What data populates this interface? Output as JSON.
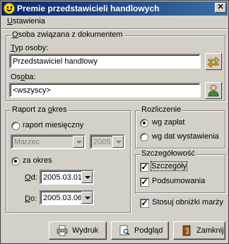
{
  "window": {
    "title": "Premie przedstawicieli handlowych"
  },
  "menu": {
    "items": [
      {
        "label_pre": "",
        "label_u": "U",
        "label_post": "stawienia"
      }
    ]
  },
  "osoba_group": {
    "legend_u": "O",
    "legend_rest": "soba związana z dokumentem",
    "typ_label_pre": "",
    "typ_label_u": "T",
    "typ_label_post": "yp osoby:",
    "typ_value": "Przedstawiciel handlowy",
    "osoba_label_pre": "Os",
    "osoba_label_u": "o",
    "osoba_label_post": "ba:",
    "osoba_value": "<wszyscy>"
  },
  "raport_group": {
    "legend_pre": "Raport za ",
    "legend_u": "o",
    "legend_post": "kres",
    "monthly_label": "raport miesięczny",
    "monthly_selected": false,
    "month_value": "Marzec",
    "year_value": "2005",
    "range_label": "za okres",
    "range_selected": true,
    "od_label_u": "O",
    "od_label_post": "d:",
    "od_value": "2005.03.01",
    "do_label_u": "D",
    "do_label_post": "o:",
    "do_value": "2005.03.06"
  },
  "rozliczenie_group": {
    "legend": "Rozliczenie",
    "opt1_label": "wg zapłat",
    "opt1_selected": true,
    "opt2_label": "wg dat wystawienia",
    "opt2_selected": false
  },
  "szczegolowosc_group": {
    "legend": "Szczegółowość",
    "detail_label": "Szczegóły",
    "detail_checked": true,
    "summary_label": "Podsumowania",
    "summary_checked": true
  },
  "discount": {
    "label": "Stosuj obniżki marży",
    "checked": true
  },
  "buttons": {
    "print": "Wydruk",
    "preview": "Podgląd",
    "close": "Zamknij"
  },
  "icons": {
    "title": "smiley-icon",
    "typ": "swap-arrows-icon",
    "osoba": "person-icon",
    "print": "printer-icon",
    "preview": "magnifier-icon",
    "close": "door-exit-icon"
  }
}
